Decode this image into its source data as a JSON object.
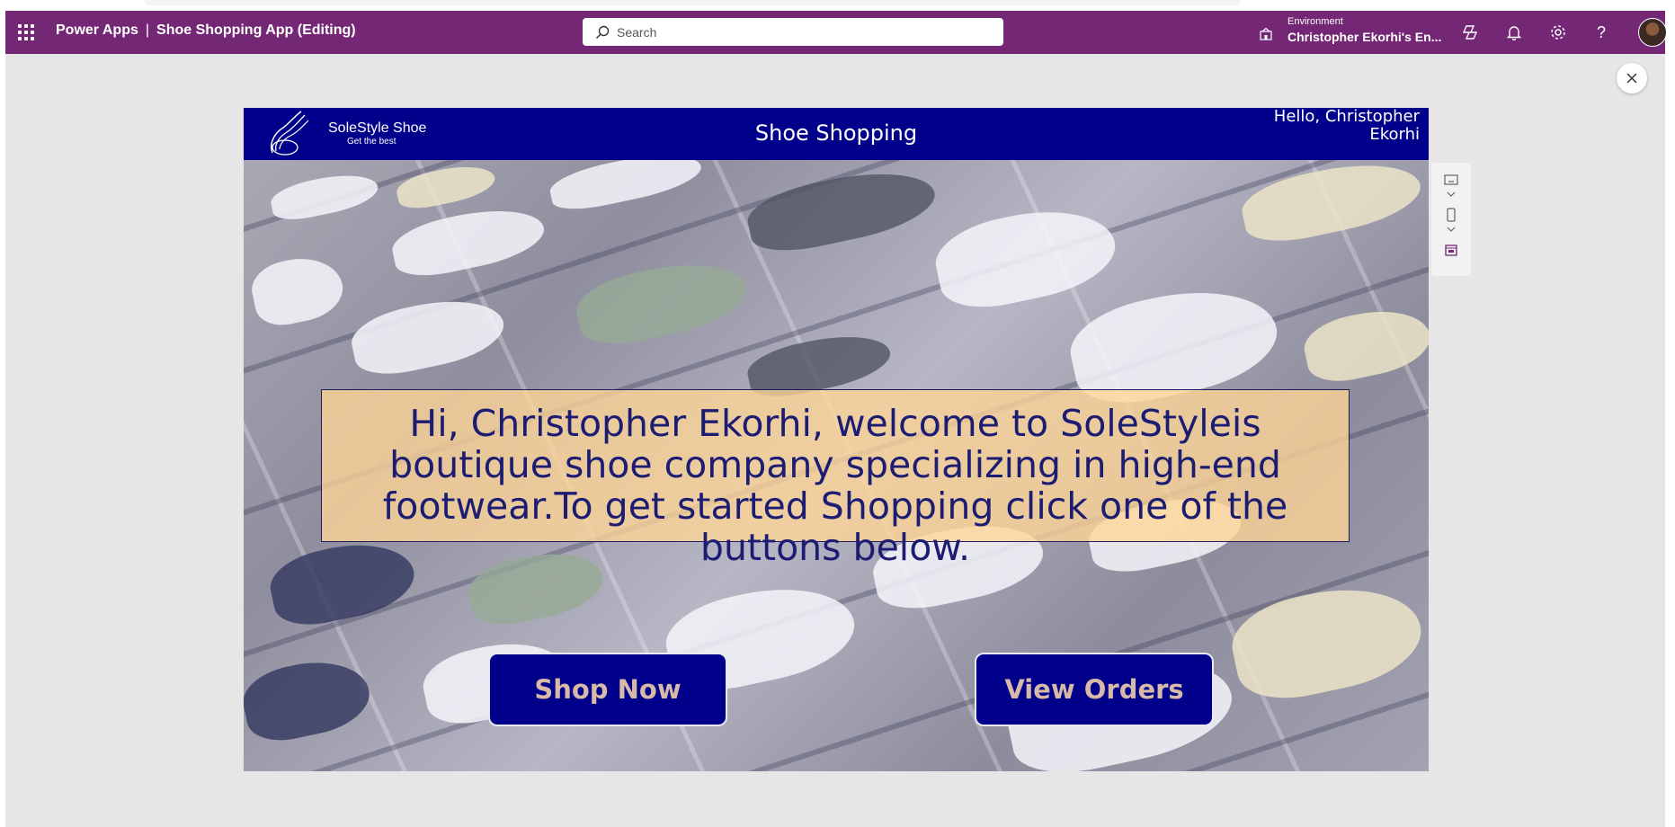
{
  "topbar": {
    "app_name": "Power Apps",
    "separator": "|",
    "doc_title": "Shoe Shopping App (Editing)",
    "search_placeholder": "Search",
    "environment_label": "Environment",
    "environment_name": "Christopher Ekorhi's En...",
    "bar_color": "#742774",
    "icons": [
      "waffle-icon",
      "search-icon",
      "environment-icon",
      "copilot-icon",
      "bell-icon",
      "gear-icon",
      "help-icon",
      "avatar"
    ]
  },
  "app": {
    "logo_name": "SoleStyle Shoe",
    "logo_tagline": "Get the best",
    "title": "Shoe Shopping",
    "greeting": "Hello, Christopher Ekorhi",
    "welcome_text": "Hi, Christopher Ekorhi, welcome to SoleStyleis boutique shoe company specializing in high-end footwear.To get started Shopping click one of the buttons below.",
    "buttons": {
      "shop_now": "Shop Now",
      "view_orders": "View Orders"
    },
    "header_color": "#00008b",
    "button_text_color": "#d8b9a8",
    "welcome_bg": "#ffd696"
  },
  "side_tools": [
    "screen-icon",
    "phone-icon",
    "calendar-icon"
  ]
}
